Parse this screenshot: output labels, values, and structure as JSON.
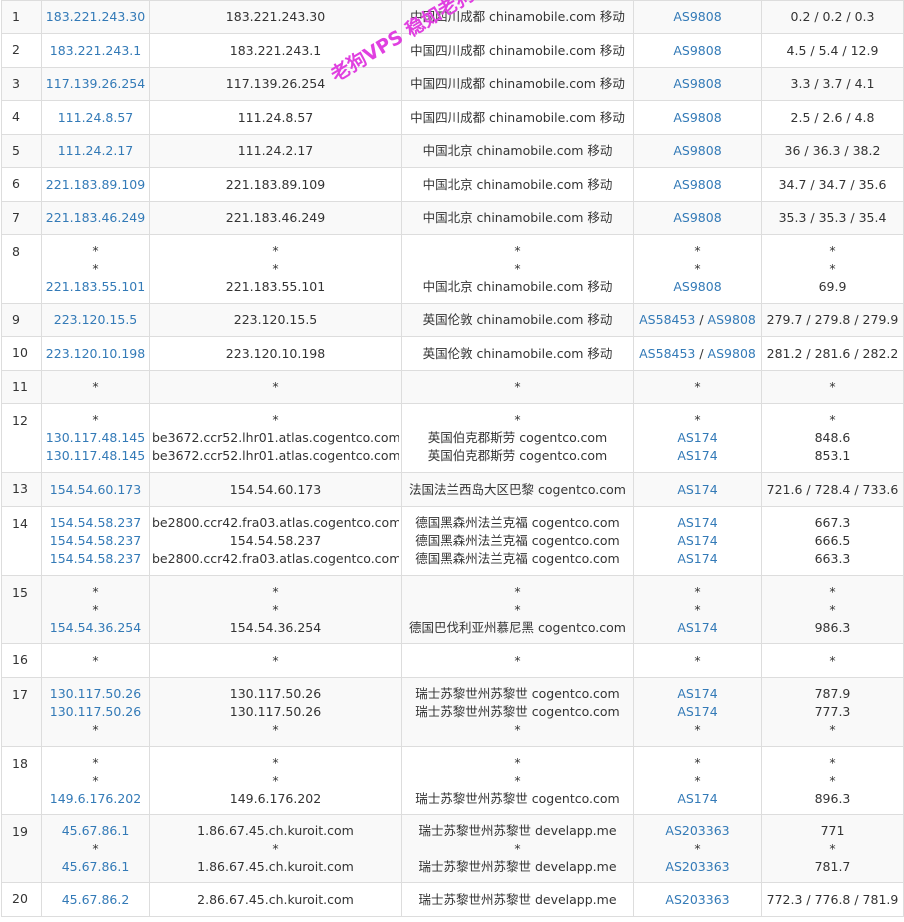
{
  "watermark": "老狗VPS 稳如老狗！",
  "hops": [
    {
      "hop": "1",
      "ip": [
        "183.221.243.30"
      ],
      "host": [
        "183.221.243.30"
      ],
      "loc": [
        "中国四川成都 chinamobile.com 移动"
      ],
      "asn": [
        [
          "AS9808"
        ]
      ],
      "rtt": [
        "0.2 / 0.2 / 0.3"
      ]
    },
    {
      "hop": "2",
      "ip": [
        "183.221.243.1"
      ],
      "host": [
        "183.221.243.1"
      ],
      "loc": [
        "中国四川成都 chinamobile.com 移动"
      ],
      "asn": [
        [
          "AS9808"
        ]
      ],
      "rtt": [
        "4.5 / 5.4 / 12.9"
      ]
    },
    {
      "hop": "3",
      "ip": [
        "117.139.26.254"
      ],
      "host": [
        "117.139.26.254"
      ],
      "loc": [
        "中国四川成都 chinamobile.com 移动"
      ],
      "asn": [
        [
          "AS9808"
        ]
      ],
      "rtt": [
        "3.3 / 3.7 / 4.1"
      ]
    },
    {
      "hop": "4",
      "ip": [
        "111.24.8.57"
      ],
      "host": [
        "111.24.8.57"
      ],
      "loc": [
        "中国四川成都 chinamobile.com 移动"
      ],
      "asn": [
        [
          "AS9808"
        ]
      ],
      "rtt": [
        "2.5 / 2.6 / 4.8"
      ]
    },
    {
      "hop": "5",
      "ip": [
        "111.24.2.17"
      ],
      "host": [
        "111.24.2.17"
      ],
      "loc": [
        "中国北京 chinamobile.com 移动"
      ],
      "asn": [
        [
          "AS9808"
        ]
      ],
      "rtt": [
        "36 / 36.3 / 38.2"
      ]
    },
    {
      "hop": "6",
      "ip": [
        "221.183.89.109"
      ],
      "host": [
        "221.183.89.109"
      ],
      "loc": [
        "中国北京 chinamobile.com 移动"
      ],
      "asn": [
        [
          "AS9808"
        ]
      ],
      "rtt": [
        "34.7 / 34.7 / 35.6"
      ]
    },
    {
      "hop": "7",
      "ip": [
        "221.183.46.249"
      ],
      "host": [
        "221.183.46.249"
      ],
      "loc": [
        "中国北京 chinamobile.com 移动"
      ],
      "asn": [
        [
          "AS9808"
        ]
      ],
      "rtt": [
        "35.3 / 35.3 / 35.4"
      ]
    },
    {
      "hop": "8",
      "ip": [
        "*",
        "*",
        "221.183.55.101"
      ],
      "host": [
        "*",
        "*",
        "221.183.55.101"
      ],
      "loc": [
        "*",
        "*",
        "中国北京 chinamobile.com 移动"
      ],
      "asn": [
        [
          "*"
        ],
        [
          "*"
        ],
        [
          "AS9808"
        ]
      ],
      "rtt": [
        "*",
        "*",
        "69.9"
      ]
    },
    {
      "hop": "9",
      "ip": [
        "223.120.15.5"
      ],
      "host": [
        "223.120.15.5"
      ],
      "loc": [
        "英国伦敦 chinamobile.com 移动"
      ],
      "asn": [
        [
          "AS58453",
          "AS9808"
        ]
      ],
      "rtt": [
        "279.7 / 279.8 / 279.9"
      ]
    },
    {
      "hop": "10",
      "ip": [
        "223.120.10.198"
      ],
      "host": [
        "223.120.10.198"
      ],
      "loc": [
        "英国伦敦 chinamobile.com 移动"
      ],
      "asn": [
        [
          "AS58453",
          "AS9808"
        ]
      ],
      "rtt": [
        "281.2 / 281.6 / 282.2"
      ]
    },
    {
      "hop": "11",
      "ip": [
        "*"
      ],
      "host": [
        "*"
      ],
      "loc": [
        "*"
      ],
      "asn": [
        [
          "*"
        ]
      ],
      "rtt": [
        "*"
      ]
    },
    {
      "hop": "12",
      "ip": [
        "*",
        "130.117.48.145",
        "130.117.48.145"
      ],
      "host": [
        "*",
        "be3672.ccr52.lhr01.atlas.cogentco.com",
        "be3672.ccr52.lhr01.atlas.cogentco.com"
      ],
      "loc": [
        "*",
        "英国伯克郡斯劳 cogentco.com",
        "英国伯克郡斯劳 cogentco.com"
      ],
      "asn": [
        [
          "*"
        ],
        [
          "AS174"
        ],
        [
          "AS174"
        ]
      ],
      "rtt": [
        "*",
        "848.6",
        "853.1"
      ]
    },
    {
      "hop": "13",
      "ip": [
        "154.54.60.173"
      ],
      "host": [
        "154.54.60.173"
      ],
      "loc": [
        "法国法兰西岛大区巴黎 cogentco.com"
      ],
      "asn": [
        [
          "AS174"
        ]
      ],
      "rtt": [
        "721.6 / 728.4 / 733.6"
      ]
    },
    {
      "hop": "14",
      "ip": [
        "154.54.58.237",
        "154.54.58.237",
        "154.54.58.237"
      ],
      "host": [
        "be2800.ccr42.fra03.atlas.cogentco.com",
        "154.54.58.237",
        "be2800.ccr42.fra03.atlas.cogentco.com"
      ],
      "loc": [
        "德国黑森州法兰克福 cogentco.com",
        "德国黑森州法兰克福 cogentco.com",
        "德国黑森州法兰克福 cogentco.com"
      ],
      "asn": [
        [
          "AS174"
        ],
        [
          "AS174"
        ],
        [
          "AS174"
        ]
      ],
      "rtt": [
        "667.3",
        "666.5",
        "663.3"
      ]
    },
    {
      "hop": "15",
      "ip": [
        "*",
        "*",
        "154.54.36.254"
      ],
      "host": [
        "*",
        "*",
        "154.54.36.254"
      ],
      "loc": [
        "*",
        "*",
        "德国巴伐利亚州慕尼黑 cogentco.com"
      ],
      "asn": [
        [
          "*"
        ],
        [
          "*"
        ],
        [
          "AS174"
        ]
      ],
      "rtt": [
        "*",
        "*",
        "986.3"
      ]
    },
    {
      "hop": "16",
      "ip": [
        "*"
      ],
      "host": [
        "*"
      ],
      "loc": [
        "*"
      ],
      "asn": [
        [
          "*"
        ]
      ],
      "rtt": [
        "*"
      ]
    },
    {
      "hop": "17",
      "ip": [
        "130.117.50.26",
        "130.117.50.26",
        "*"
      ],
      "host": [
        "130.117.50.26",
        "130.117.50.26",
        "*"
      ],
      "loc": [
        "瑞士苏黎世州苏黎世 cogentco.com",
        "瑞士苏黎世州苏黎世 cogentco.com",
        "*"
      ],
      "asn": [
        [
          "AS174"
        ],
        [
          "AS174"
        ],
        [
          "*"
        ]
      ],
      "rtt": [
        "787.9",
        "777.3",
        "*"
      ]
    },
    {
      "hop": "18",
      "ip": [
        "*",
        "*",
        "149.6.176.202"
      ],
      "host": [
        "*",
        "*",
        "149.6.176.202"
      ],
      "loc": [
        "*",
        "*",
        "瑞士苏黎世州苏黎世 cogentco.com"
      ],
      "asn": [
        [
          "*"
        ],
        [
          "*"
        ],
        [
          "AS174"
        ]
      ],
      "rtt": [
        "*",
        "*",
        "896.3"
      ]
    },
    {
      "hop": "19",
      "ip": [
        "45.67.86.1",
        "*",
        "45.67.86.1"
      ],
      "host": [
        "1.86.67.45.ch.kuroit.com",
        "*",
        "1.86.67.45.ch.kuroit.com"
      ],
      "loc": [
        "瑞士苏黎世州苏黎世 develapp.me",
        "*",
        "瑞士苏黎世州苏黎世 develapp.me"
      ],
      "asn": [
        [
          "AS203363"
        ],
        [
          "*"
        ],
        [
          "AS203363"
        ]
      ],
      "rtt": [
        "771",
        "*",
        "781.7"
      ]
    },
    {
      "hop": "20",
      "ip": [
        "45.67.86.2"
      ],
      "host": [
        "2.86.67.45.ch.kuroit.com"
      ],
      "loc": [
        "瑞士苏黎世州苏黎世 develapp.me"
      ],
      "asn": [
        [
          "AS203363"
        ]
      ],
      "rtt": [
        "772.3 / 776.8 / 781.9"
      ]
    }
  ]
}
